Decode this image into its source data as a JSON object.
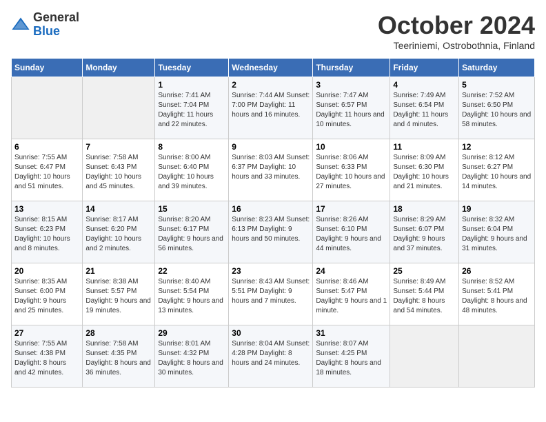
{
  "header": {
    "logo_line1": "General",
    "logo_line2": "Blue",
    "month": "October 2024",
    "location": "Teeriniemi, Ostrobothnia, Finland"
  },
  "weekdays": [
    "Sunday",
    "Monday",
    "Tuesday",
    "Wednesday",
    "Thursday",
    "Friday",
    "Saturday"
  ],
  "weeks": [
    [
      {
        "day": "",
        "info": ""
      },
      {
        "day": "",
        "info": ""
      },
      {
        "day": "1",
        "info": "Sunrise: 7:41 AM\nSunset: 7:04 PM\nDaylight: 11 hours\nand 22 minutes."
      },
      {
        "day": "2",
        "info": "Sunrise: 7:44 AM\nSunset: 7:00 PM\nDaylight: 11 hours\nand 16 minutes."
      },
      {
        "day": "3",
        "info": "Sunrise: 7:47 AM\nSunset: 6:57 PM\nDaylight: 11 hours\nand 10 minutes."
      },
      {
        "day": "4",
        "info": "Sunrise: 7:49 AM\nSunset: 6:54 PM\nDaylight: 11 hours\nand 4 minutes."
      },
      {
        "day": "5",
        "info": "Sunrise: 7:52 AM\nSunset: 6:50 PM\nDaylight: 10 hours\nand 58 minutes."
      }
    ],
    [
      {
        "day": "6",
        "info": "Sunrise: 7:55 AM\nSunset: 6:47 PM\nDaylight: 10 hours\nand 51 minutes."
      },
      {
        "day": "7",
        "info": "Sunrise: 7:58 AM\nSunset: 6:43 PM\nDaylight: 10 hours\nand 45 minutes."
      },
      {
        "day": "8",
        "info": "Sunrise: 8:00 AM\nSunset: 6:40 PM\nDaylight: 10 hours\nand 39 minutes."
      },
      {
        "day": "9",
        "info": "Sunrise: 8:03 AM\nSunset: 6:37 PM\nDaylight: 10 hours\nand 33 minutes."
      },
      {
        "day": "10",
        "info": "Sunrise: 8:06 AM\nSunset: 6:33 PM\nDaylight: 10 hours\nand 27 minutes."
      },
      {
        "day": "11",
        "info": "Sunrise: 8:09 AM\nSunset: 6:30 PM\nDaylight: 10 hours\nand 21 minutes."
      },
      {
        "day": "12",
        "info": "Sunrise: 8:12 AM\nSunset: 6:27 PM\nDaylight: 10 hours\nand 14 minutes."
      }
    ],
    [
      {
        "day": "13",
        "info": "Sunrise: 8:15 AM\nSunset: 6:23 PM\nDaylight: 10 hours\nand 8 minutes."
      },
      {
        "day": "14",
        "info": "Sunrise: 8:17 AM\nSunset: 6:20 PM\nDaylight: 10 hours\nand 2 minutes."
      },
      {
        "day": "15",
        "info": "Sunrise: 8:20 AM\nSunset: 6:17 PM\nDaylight: 9 hours\nand 56 minutes."
      },
      {
        "day": "16",
        "info": "Sunrise: 8:23 AM\nSunset: 6:13 PM\nDaylight: 9 hours\nand 50 minutes."
      },
      {
        "day": "17",
        "info": "Sunrise: 8:26 AM\nSunset: 6:10 PM\nDaylight: 9 hours\nand 44 minutes."
      },
      {
        "day": "18",
        "info": "Sunrise: 8:29 AM\nSunset: 6:07 PM\nDaylight: 9 hours\nand 37 minutes."
      },
      {
        "day": "19",
        "info": "Sunrise: 8:32 AM\nSunset: 6:04 PM\nDaylight: 9 hours\nand 31 minutes."
      }
    ],
    [
      {
        "day": "20",
        "info": "Sunrise: 8:35 AM\nSunset: 6:00 PM\nDaylight: 9 hours\nand 25 minutes."
      },
      {
        "day": "21",
        "info": "Sunrise: 8:38 AM\nSunset: 5:57 PM\nDaylight: 9 hours\nand 19 minutes."
      },
      {
        "day": "22",
        "info": "Sunrise: 8:40 AM\nSunset: 5:54 PM\nDaylight: 9 hours\nand 13 minutes."
      },
      {
        "day": "23",
        "info": "Sunrise: 8:43 AM\nSunset: 5:51 PM\nDaylight: 9 hours\nand 7 minutes."
      },
      {
        "day": "24",
        "info": "Sunrise: 8:46 AM\nSunset: 5:47 PM\nDaylight: 9 hours\nand 1 minute."
      },
      {
        "day": "25",
        "info": "Sunrise: 8:49 AM\nSunset: 5:44 PM\nDaylight: 8 hours\nand 54 minutes."
      },
      {
        "day": "26",
        "info": "Sunrise: 8:52 AM\nSunset: 5:41 PM\nDaylight: 8 hours\nand 48 minutes."
      }
    ],
    [
      {
        "day": "27",
        "info": "Sunrise: 7:55 AM\nSunset: 4:38 PM\nDaylight: 8 hours\nand 42 minutes."
      },
      {
        "day": "28",
        "info": "Sunrise: 7:58 AM\nSunset: 4:35 PM\nDaylight: 8 hours\nand 36 minutes."
      },
      {
        "day": "29",
        "info": "Sunrise: 8:01 AM\nSunset: 4:32 PM\nDaylight: 8 hours\nand 30 minutes."
      },
      {
        "day": "30",
        "info": "Sunrise: 8:04 AM\nSunset: 4:28 PM\nDaylight: 8 hours\nand 24 minutes."
      },
      {
        "day": "31",
        "info": "Sunrise: 8:07 AM\nSunset: 4:25 PM\nDaylight: 8 hours\nand 18 minutes."
      },
      {
        "day": "",
        "info": ""
      },
      {
        "day": "",
        "info": ""
      }
    ]
  ]
}
